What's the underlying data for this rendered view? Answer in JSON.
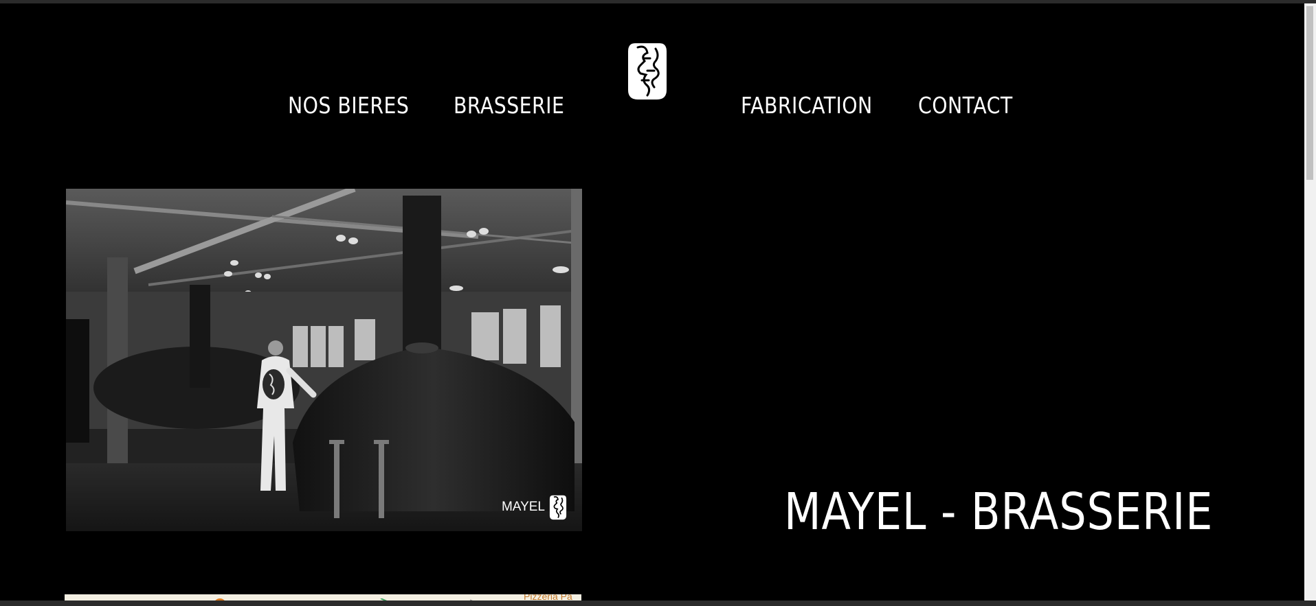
{
  "nav": {
    "items": [
      {
        "label": "NOS BIERES"
      },
      {
        "label": "BRASSERIE"
      },
      {
        "label": "FABRICATION"
      },
      {
        "label": "CONTACT"
      }
    ],
    "logo_icon": "face-logo-icon"
  },
  "hero": {
    "watermark": "MAYEL",
    "title": "MAYEL - BRASSERIE"
  },
  "map": {
    "label": "Pizzeria Pa"
  },
  "colors": {
    "background": "#000000",
    "text": "#ffffff"
  }
}
